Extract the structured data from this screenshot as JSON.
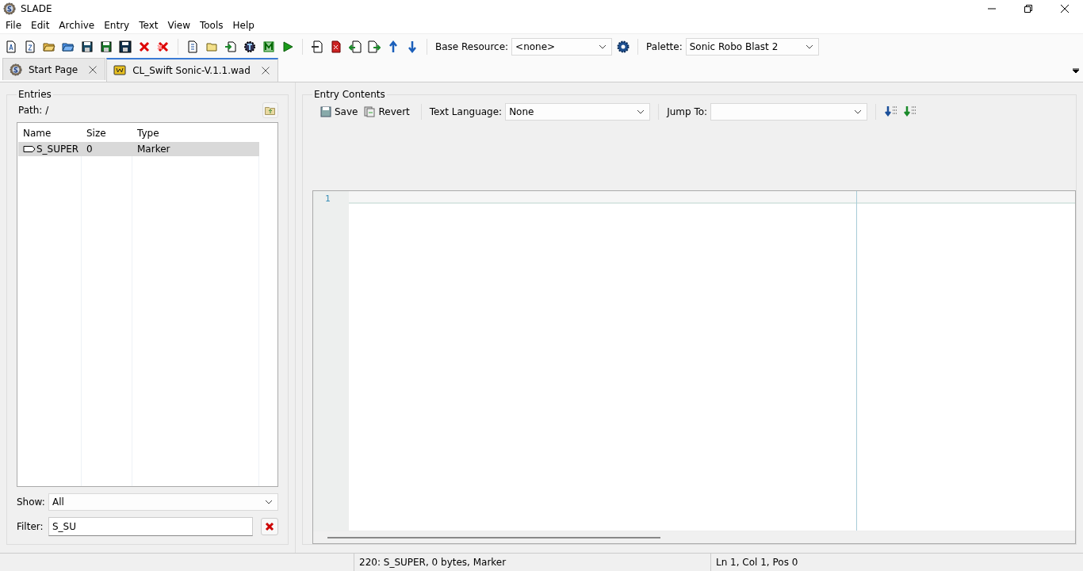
{
  "window": {
    "title": "SLADE"
  },
  "menu": [
    "File",
    "Edit",
    "Archive",
    "Entry",
    "Text",
    "View",
    "Tools",
    "Help"
  ],
  "toolbar": {
    "base_resource_label": "Base Resource:",
    "base_resource": "<none>",
    "palette_label": "Palette:",
    "palette": "Sonic Robo Blast 2"
  },
  "tabs": [
    {
      "label": "Start Page",
      "kind": "start",
      "selected": false
    },
    {
      "label": "CL_Swift Sonic-V.1.1.wad",
      "kind": "wad",
      "selected": true
    }
  ],
  "entries": {
    "title": "Entries",
    "path": "Path: /",
    "columns": [
      "Name",
      "Size",
      "Type"
    ],
    "rows": [
      {
        "cells": [
          "S_SUPER",
          "0",
          "Marker"
        ],
        "selected": true
      }
    ],
    "show_label": "Show:",
    "show": "All",
    "filter_label": "Filter:",
    "filter": "S_SU"
  },
  "entry_contents": {
    "title": "Entry Contents",
    "save": "Save",
    "revert": "Revert",
    "language_label": "Text Language:",
    "language": "None",
    "jump_label": "Jump To:",
    "line_numbers": [
      "1"
    ]
  },
  "status_bar": [
    "220: S_SUPER, 0 bytes, Marker",
    "Ln 1, Col 1, Pos 0"
  ]
}
